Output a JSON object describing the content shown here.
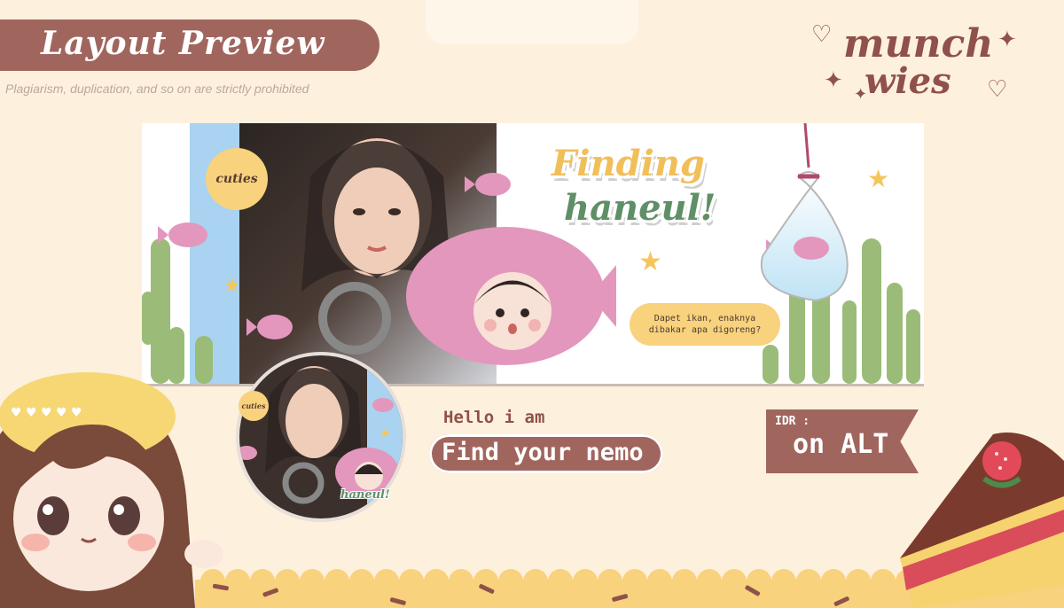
{
  "header": {
    "title": "Layout Preview",
    "subtitle": "Plagiarism, duplication, and so on are strictly prohibited"
  },
  "brand": {
    "line1": "munch",
    "line2": "wies"
  },
  "banner": {
    "title_line1": "Finding",
    "title_line2": "haneul!",
    "badge": "cuties",
    "speech_line1": "Dapet ikan, enaknya",
    "speech_line2": "dibakar apa digoreng?"
  },
  "avatar": {
    "badge": "cuties",
    "tag": "haneul!"
  },
  "profile": {
    "greeting": "Hello i am",
    "name": "Find your nemo"
  },
  "price": {
    "label": "IDR :",
    "value": "on ALT"
  },
  "colors": {
    "background": "#fdf0dd",
    "accent_brown": "#a0665e",
    "yellow": "#f8d27c",
    "green_text": "#5e8f66",
    "fish_pink": "#e397bd"
  },
  "icons": [
    "heart-icon",
    "sparkle-icon",
    "star-icon",
    "fish-icon",
    "cactus-icon",
    "cake-icon",
    "chibi-girl-icon"
  ]
}
